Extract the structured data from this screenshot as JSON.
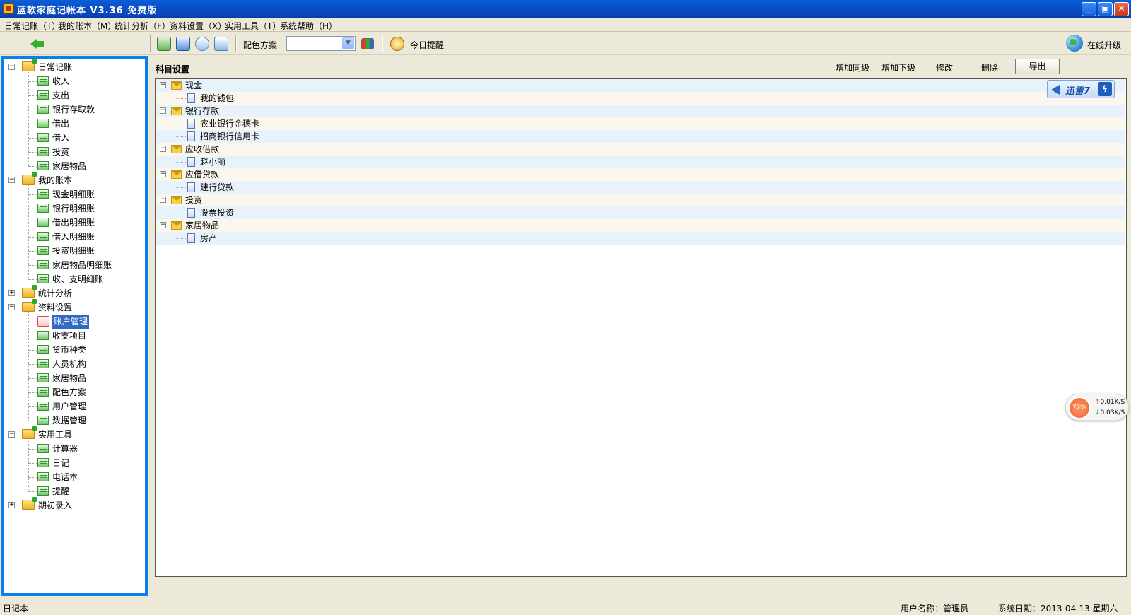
{
  "window": {
    "title": "蓝软家庭记帐本 V3.36  免费版",
    "min_label": "_",
    "max_label": "▣",
    "close_label": "✕"
  },
  "menu": [
    {
      "label": "日常记账（T）"
    },
    {
      "label": "我的账本（M）"
    },
    {
      "label": "统计分析（F）"
    },
    {
      "label": "资料设置（X）"
    },
    {
      "label": "实用工具（T）"
    },
    {
      "label": "系统帮助（H）"
    }
  ],
  "toolbar": {
    "color_scheme_label": "配色方案",
    "color_scheme_value": "",
    "reminder_label": "今日提醒",
    "upgrade_label": "在线升级"
  },
  "tree": [
    {
      "label": "日常记账",
      "type": "folder",
      "expanded": true,
      "children": [
        "收入",
        "支出",
        "银行存取款",
        "借出",
        "借入",
        "投资",
        "家居物品"
      ]
    },
    {
      "label": "我的账本",
      "type": "folder",
      "expanded": true,
      "children": [
        "现金明细账",
        "银行明细账",
        "借出明细账",
        "借入明细账",
        "投资明细账",
        "家居物品明细账",
        "收、支明细账"
      ]
    },
    {
      "label": "统计分析",
      "type": "folder",
      "expanded": false,
      "children": []
    },
    {
      "label": "资料设置",
      "type": "folder",
      "expanded": true,
      "children": [
        "账户管理",
        "收支项目",
        "货币种类",
        "人员机构",
        "家居物品",
        "配色方案",
        "用户管理",
        "数据管理"
      ]
    },
    {
      "label": "实用工具",
      "type": "folder",
      "expanded": true,
      "children": [
        "计算器",
        "日记",
        "电话本",
        "提醒"
      ]
    },
    {
      "label": "期初录入",
      "type": "folder",
      "expanded": false,
      "children": []
    }
  ],
  "selected_tree_item": "账户管理",
  "main": {
    "section_title": "科目设置",
    "actions": {
      "add_sibling": "增加同级",
      "add_child": "增加下级",
      "edit": "修改",
      "delete": "删除",
      "export": "导出"
    },
    "accounts": [
      {
        "label": "现金",
        "children": [
          "我的钱包"
        ]
      },
      {
        "label": "银行存款",
        "children": [
          "农业银行金穗卡",
          "招商银行信用卡"
        ]
      },
      {
        "label": "应收借款",
        "children": [
          "赵小丽"
        ]
      },
      {
        "label": "应借贷款",
        "children": [
          "建行贷款"
        ]
      },
      {
        "label": "投资",
        "children": [
          "股票投资"
        ]
      },
      {
        "label": "家居物品",
        "children": [
          "房产"
        ]
      }
    ]
  },
  "overlay": {
    "xunlei_label": "迅雷7",
    "net_percent": "72%",
    "net_up": "0.01K/S",
    "net_down": "0.03K/S"
  },
  "status": {
    "left": "日记本",
    "user": "用户名称：管理员",
    "date": "系统日期：2013-04-13  星期六"
  }
}
